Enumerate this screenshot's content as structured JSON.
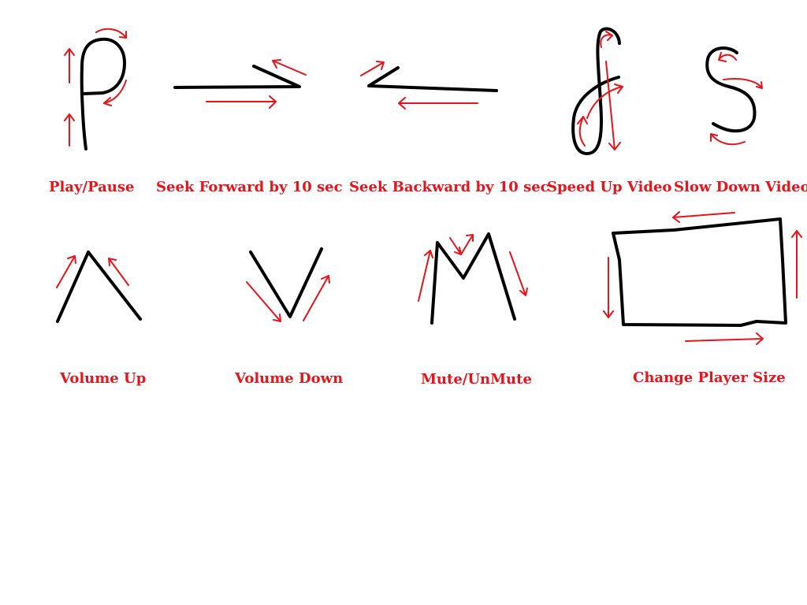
{
  "colors": {
    "background": "#ffffff",
    "stroke": "#000000",
    "arrow": "#e8141b",
    "label": "#e8141b"
  },
  "gestures": [
    {
      "id": "play-pause",
      "label": "Play/Pause",
      "shape": "P"
    },
    {
      "id": "seek-forward",
      "label": "Seek Forward by 10 sec",
      "shape": "right-arrow"
    },
    {
      "id": "seek-backward",
      "label": "Seek Backward by 10 sec",
      "shape": "left-arrow"
    },
    {
      "id": "speed-up",
      "label": "Speed Up Video",
      "shape": "loop-up"
    },
    {
      "id": "slow-down",
      "label": "Slow Down Video",
      "shape": "S"
    },
    {
      "id": "volume-up",
      "label": "Volume Up",
      "shape": "caret-up"
    },
    {
      "id": "volume-down",
      "label": "Volume Down",
      "shape": "V"
    },
    {
      "id": "mute",
      "label": "Mute/UnMute",
      "shape": "M"
    },
    {
      "id": "player-size",
      "label": "Change Player Size",
      "shape": "rectangle"
    }
  ]
}
